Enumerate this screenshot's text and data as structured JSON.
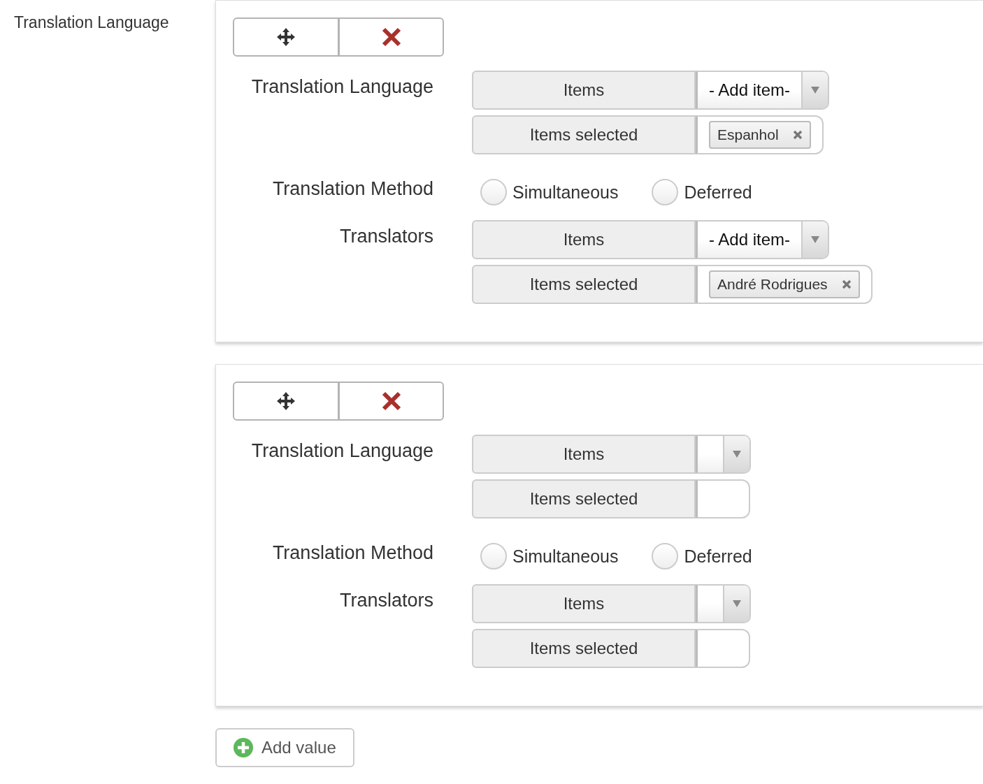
{
  "field_label": "Translation Language",
  "entries": [
    {
      "rows": [
        {
          "kind": "select",
          "label": "Translation Language",
          "addon": "Items",
          "placeholder": "- Add item-",
          "selected_addon": "Items selected",
          "tags": [
            "Espanhol"
          ]
        },
        {
          "kind": "radio",
          "label": "Translation Method",
          "options": [
            {
              "label": "Simultaneous",
              "selected": false
            },
            {
              "label": "Deferred",
              "selected": false
            }
          ]
        },
        {
          "kind": "select",
          "label": "Translators",
          "addon": "Items",
          "placeholder": "- Add item-",
          "selected_addon": "Items selected",
          "tags": [
            "André Rodrigues"
          ]
        }
      ]
    },
    {
      "rows": [
        {
          "kind": "select",
          "label": "Translation Language",
          "addon": "Items",
          "selected_addon": "Items selected",
          "tags": []
        },
        {
          "kind": "radio",
          "label": "Translation Method",
          "options": [
            {
              "label": "Simultaneous",
              "selected": false
            },
            {
              "label": "Deferred",
              "selected": false
            }
          ]
        },
        {
          "kind": "select",
          "label": "Translators",
          "addon": "Items",
          "selected_addon": "Items selected",
          "tags": []
        }
      ]
    }
  ],
  "add_button": "Add value"
}
